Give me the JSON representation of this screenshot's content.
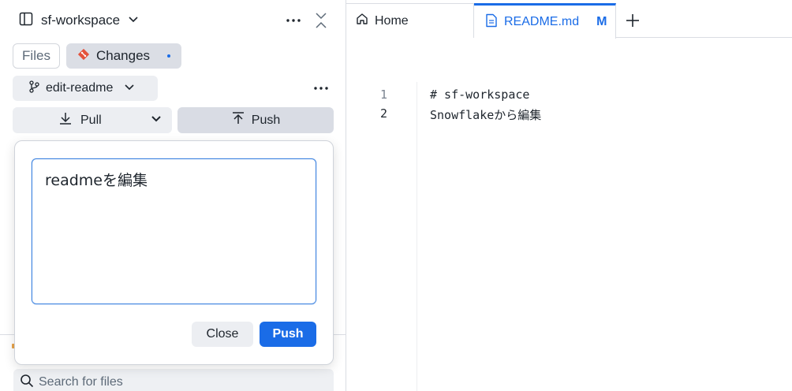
{
  "sidebar": {
    "workspace_name": "sf-workspace",
    "tabs": [
      {
        "label": "Files",
        "active": false
      },
      {
        "label": "Changes",
        "active": true
      }
    ],
    "branch": "edit-readme",
    "pull_label": "Pull",
    "push_label": "Push",
    "search_placeholder": "Search for files"
  },
  "commit_popover": {
    "message": "readmeを編集",
    "close_label": "Close",
    "push_label": "Push"
  },
  "editor": {
    "tabs": [
      {
        "label": "Home",
        "icon": "home-icon",
        "active": false
      },
      {
        "label": "README.md",
        "icon": "file-icon",
        "active": true,
        "badge": "M"
      }
    ],
    "lines": [
      {
        "number": "1",
        "text": "# sf-workspace"
      },
      {
        "number": "2",
        "text": "Snowflakeから編集"
      }
    ]
  },
  "colors": {
    "accent": "#1a6ce7",
    "git_icon": "#e4523b",
    "muted_bg": "#eceef2"
  }
}
